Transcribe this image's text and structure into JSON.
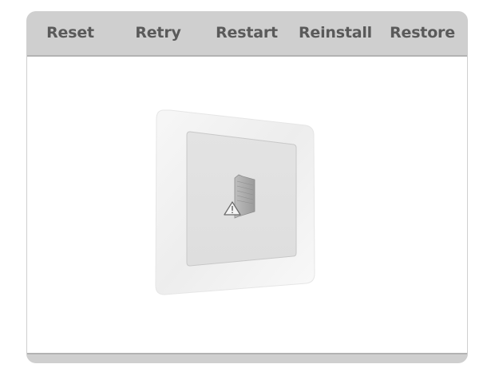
{
  "tabs": [
    {
      "label": "Reset"
    },
    {
      "label": "Retry"
    },
    {
      "label": "Restart"
    },
    {
      "label": "Reinstall"
    },
    {
      "label": "Restore"
    }
  ],
  "illustration": {
    "device": "tablet-screen",
    "icon": "folder-warning-icon"
  },
  "colors": {
    "frame": "#cfcfcf",
    "tab_text": "#5a5a5a",
    "content_bg": "#ffffff",
    "screen": "#e2e2e2"
  }
}
